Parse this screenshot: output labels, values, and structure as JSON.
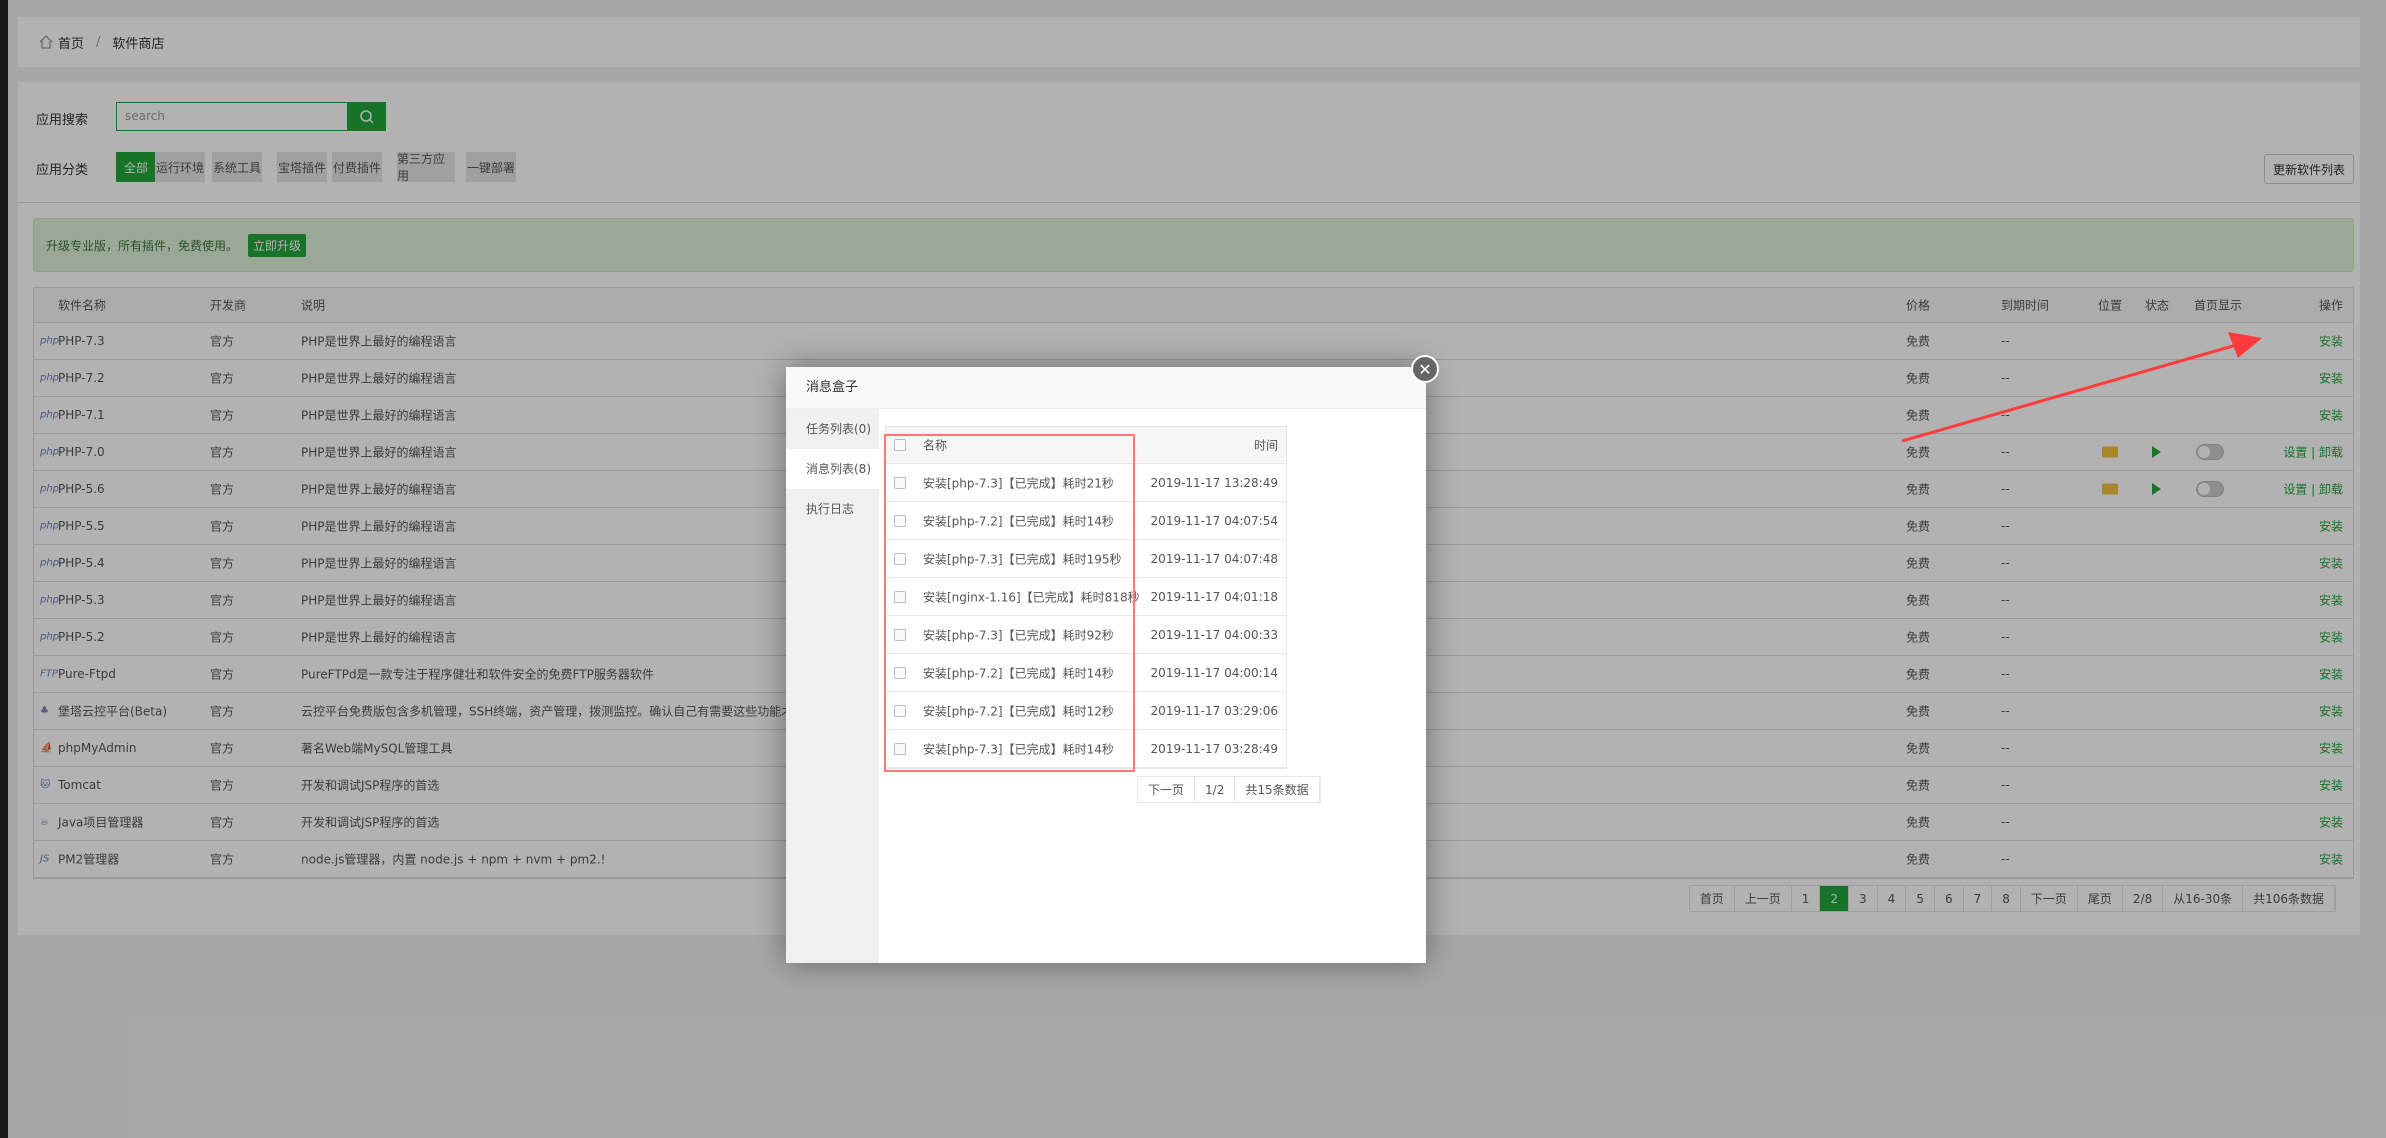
{
  "breadcrumb": {
    "home": "首页",
    "sep": "/",
    "current": "软件商店"
  },
  "search": {
    "label": "应用搜索",
    "placeholder": "search"
  },
  "categories": {
    "label": "应用分类",
    "items": [
      "全部",
      "运行环境",
      "系统工具",
      "宝塔插件",
      "付费插件",
      "第三方应用",
      "一键部署"
    ],
    "active": 0
  },
  "update_button": "更新软件列表",
  "alert": {
    "text": "升级专业版，所有插件，免费使用。",
    "button": "立即升级"
  },
  "table": {
    "headers": {
      "name": "软件名称",
      "dev": "开发商",
      "desc": "说明",
      "price": "价格",
      "expire": "到期时间",
      "loc": "位置",
      "state": "状态",
      "home": "首页显示",
      "op": "操作"
    },
    "rows": [
      {
        "icon": "php",
        "name": "PHP-7.3",
        "dev": "官方",
        "desc": "PHP是世界上最好的编程语言",
        "price": "免费",
        "expire": "--",
        "op": "安装"
      },
      {
        "icon": "php",
        "name": "PHP-7.2",
        "dev": "官方",
        "desc": "PHP是世界上最好的编程语言",
        "price": "免费",
        "expire": "--",
        "op": "安装"
      },
      {
        "icon": "php",
        "name": "PHP-7.1",
        "dev": "官方",
        "desc": "PHP是世界上最好的编程语言",
        "price": "免费",
        "expire": "--",
        "op": "安装"
      },
      {
        "icon": "php",
        "name": "PHP-7.0",
        "dev": "官方",
        "desc": "PHP是世界上最好的编程语言",
        "price": "免费",
        "expire": "--",
        "op": "设置 | 卸载",
        "installed": true
      },
      {
        "icon": "php",
        "name": "PHP-5.6",
        "dev": "官方",
        "desc": "PHP是世界上最好的编程语言",
        "price": "免费",
        "expire": "--",
        "op": "设置 | 卸载",
        "installed": true
      },
      {
        "icon": "php",
        "name": "PHP-5.5",
        "dev": "官方",
        "desc": "PHP是世界上最好的编程语言",
        "price": "免费",
        "expire": "--",
        "op": "安装"
      },
      {
        "icon": "php",
        "name": "PHP-5.4",
        "dev": "官方",
        "desc": "PHP是世界上最好的编程语言",
        "price": "免费",
        "expire": "--",
        "op": "安装"
      },
      {
        "icon": "php",
        "name": "PHP-5.3",
        "dev": "官方",
        "desc": "PHP是世界上最好的编程语言",
        "price": "免费",
        "expire": "--",
        "op": "安装"
      },
      {
        "icon": "php",
        "name": "PHP-5.2",
        "dev": "官方",
        "desc": "PHP是世界上最好的编程语言",
        "price": "免费",
        "expire": "--",
        "op": "安装"
      },
      {
        "icon": "FTP",
        "name": "Pure-Ftpd",
        "dev": "官方",
        "desc": "PureFTPd是一款专注于程序健壮和软件安全的免费FTP服务器软件",
        "price": "免费",
        "expire": "--",
        "op": "安装"
      },
      {
        "icon": "♣",
        "name": "堡塔云控平台(Beta)",
        "dev": "官方",
        "desc": "云控平台免费版包含多机管理，SSH终端，资产管理，拨测监控。确认自己有需要这些功能才",
        "price": "免费",
        "expire": "--",
        "op": "安装"
      },
      {
        "icon": "⛵",
        "name": "phpMyAdmin",
        "dev": "官方",
        "desc": "著名Web端MySQL管理工具",
        "price": "免费",
        "expire": "--",
        "op": "安装"
      },
      {
        "icon": "🐱",
        "name": "Tomcat",
        "dev": "官方",
        "desc": "开发和调试JSP程序的首选",
        "price": "免费",
        "expire": "--",
        "op": "安装"
      },
      {
        "icon": "☕",
        "name": "Java项目管理器",
        "dev": "官方",
        "desc": "开发和调试JSP程序的首选",
        "price": "免费",
        "expire": "--",
        "op": "安装"
      },
      {
        "icon": "JS",
        "name": "PM2管理器",
        "dev": "官方",
        "desc": "node.js管理器，内置 node.js + npm + nvm + pm2.!",
        "price": "免费",
        "expire": "--",
        "op": "安装"
      }
    ]
  },
  "pagination": [
    "首页",
    "上一页",
    "1",
    "2",
    "3",
    "4",
    "5",
    "6",
    "7",
    "8",
    "下一页",
    "尾页",
    "2/8",
    "从16-30条",
    "共106条数据"
  ],
  "pagination_active": "2",
  "modal": {
    "title": "消息盒子",
    "tabs": [
      "任务列表(0)",
      "消息列表(8)",
      "执行日志"
    ],
    "active_tab": 1,
    "headers": {
      "name": "名称",
      "time": "时间"
    },
    "rows": [
      {
        "name": "安装[php-7.3]【已完成】耗时21秒",
        "time": "2019-11-17 13:28:49"
      },
      {
        "name": "安装[php-7.2]【已完成】耗时14秒",
        "time": "2019-11-17 04:07:54"
      },
      {
        "name": "安装[php-7.3]【已完成】耗时195秒",
        "time": "2019-11-17 04:07:48"
      },
      {
        "name": "安装[nginx-1.16]【已完成】耗时818秒",
        "time": "2019-11-17 04:01:18"
      },
      {
        "name": "安装[php-7.3]【已完成】耗时92秒",
        "time": "2019-11-17 04:00:33"
      },
      {
        "name": "安装[php-7.2]【已完成】耗时14秒",
        "time": "2019-11-17 04:00:14"
      },
      {
        "name": "安装[php-7.2]【已完成】耗时12秒",
        "time": "2019-11-17 03:29:06"
      },
      {
        "name": "安装[php-7.3]【已完成】耗时14秒",
        "time": "2019-11-17 03:28:49"
      }
    ],
    "pager": [
      "下一页",
      "1/2",
      "共15条数据"
    ]
  },
  "colors": {
    "accent": "#20a53a",
    "annotation": "#ff3b3b"
  }
}
